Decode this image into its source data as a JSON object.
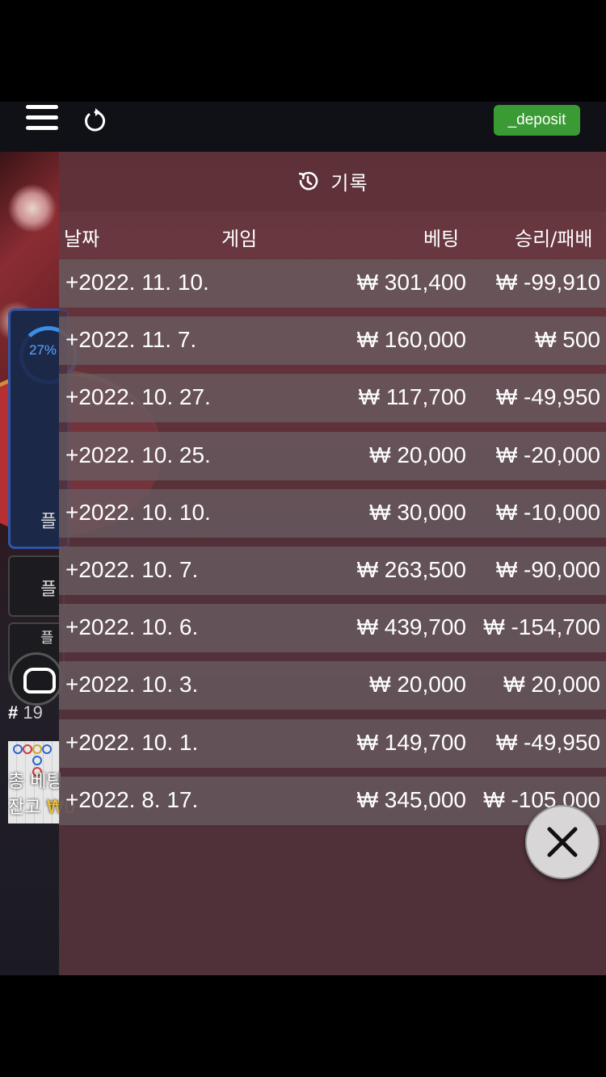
{
  "topbar": {
    "deposit_label": "_deposit"
  },
  "background": {
    "progress_pct": "27%",
    "side_labels": [
      "플",
      "플",
      "플"
    ],
    "hash_prefix": "#",
    "hash_value": "19",
    "total_bet_label": "총 베팅",
    "balance_label": "잔고",
    "balance_currency": "₩",
    "balance_value": "0"
  },
  "history": {
    "title": "기록",
    "columns": {
      "date": "날짜",
      "game": "게임",
      "bet": "베팅",
      "winloss": "승리/패배"
    },
    "rows": [
      {
        "date": "+2022. 11. 10.",
        "bet": "₩ 301,400",
        "winloss": "₩ -99,910"
      },
      {
        "date": "+2022. 11. 7.",
        "bet": "₩ 160,000",
        "winloss": "₩ 500"
      },
      {
        "date": "+2022. 10. 27.",
        "bet": "₩ 117,700",
        "winloss": "₩ -49,950"
      },
      {
        "date": "+2022. 10. 25.",
        "bet": "₩ 20,000",
        "winloss": "₩ -20,000"
      },
      {
        "date": "+2022. 10. 10.",
        "bet": "₩ 30,000",
        "winloss": "₩ -10,000"
      },
      {
        "date": "+2022. 10. 7.",
        "bet": "₩ 263,500",
        "winloss": "₩ -90,000"
      },
      {
        "date": "+2022. 10. 6.",
        "bet": "₩ 439,700",
        "winloss": "₩ -154,700"
      },
      {
        "date": "+2022. 10. 3.",
        "bet": "₩ 20,000",
        "winloss": "₩ 20,000"
      },
      {
        "date": "+2022. 10. 1.",
        "bet": "₩ 149,700",
        "winloss": "₩ -49,950"
      },
      {
        "date": "+2022. 8. 17.",
        "bet": "₩ 345,000",
        "winloss": "₩ -105,000"
      }
    ]
  },
  "icons": {
    "menu": "hamburger-icon",
    "reload": "reload-icon",
    "history": "history-icon",
    "close": "close-icon"
  },
  "colors": {
    "deposit_bg": "#3a9a34",
    "overlay": "#5f3740",
    "progress": "#3b8ee6"
  }
}
